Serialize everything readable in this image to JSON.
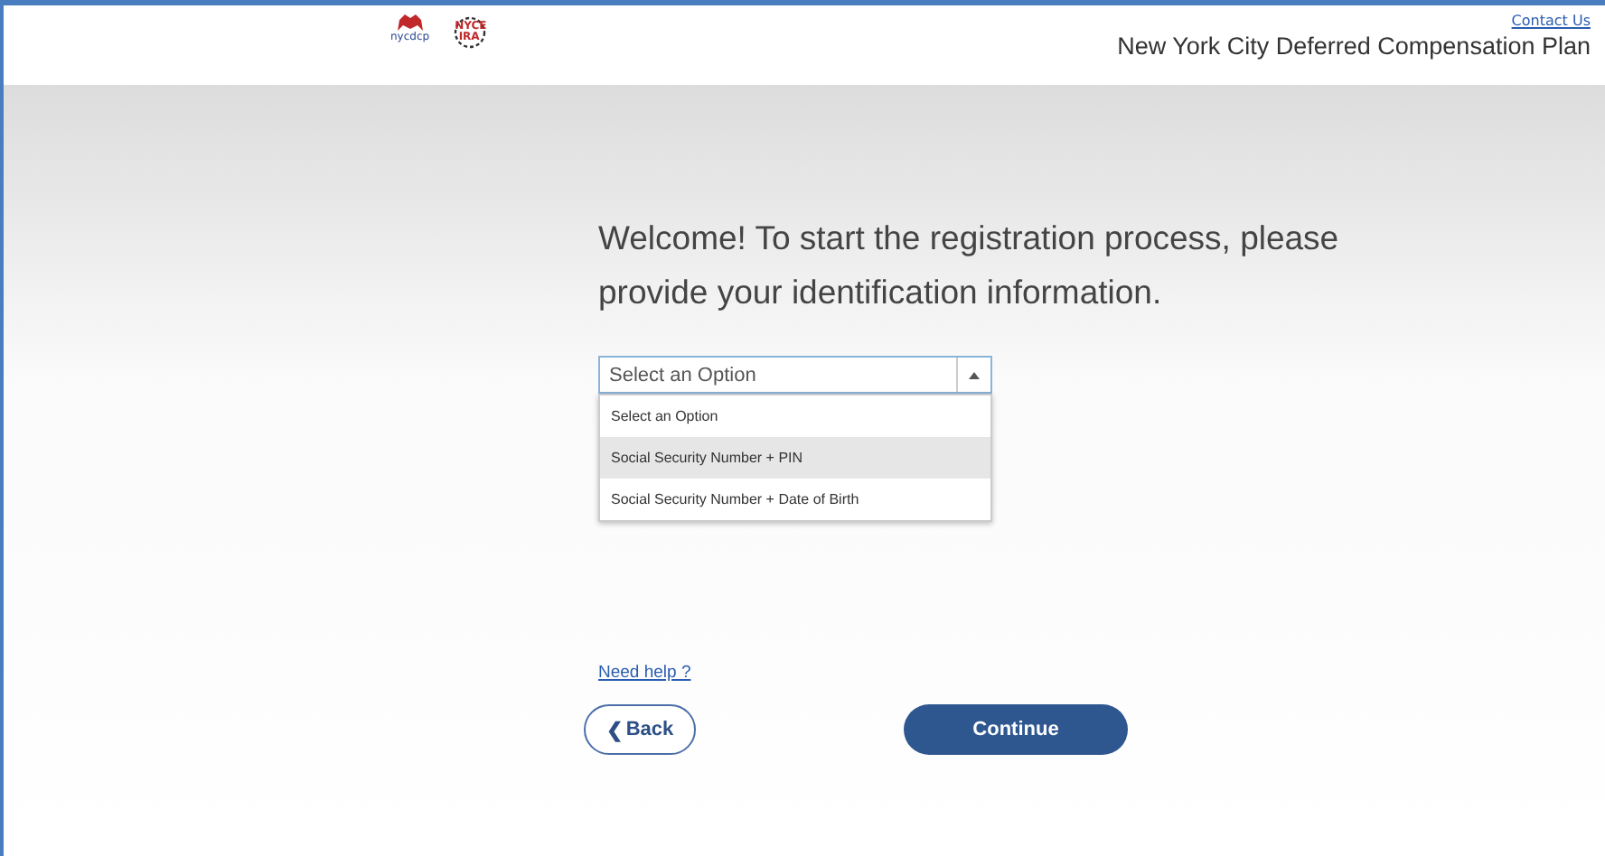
{
  "header": {
    "logos": [
      {
        "kind": "dcp",
        "text": "nycdcp"
      },
      {
        "kind": "ira",
        "text": "NYCE IRA"
      }
    ],
    "contact_link": "Contact Us",
    "title": "New York City Deferred Compensation Plan"
  },
  "heading": "Welcome! To start the registration process, please provide your identification information.",
  "dropdown": {
    "value": "Select an Option",
    "expanded": true,
    "options": [
      {
        "label": "Select an Option",
        "highlighted": false
      },
      {
        "label": "Social Security Number + PIN",
        "highlighted": true
      },
      {
        "label": "Social Security Number + Date of Birth",
        "highlighted": false
      }
    ]
  },
  "help_link": "Need help ?",
  "buttons": {
    "back": "Back",
    "back_icon": "❮",
    "continue": "Continue"
  }
}
